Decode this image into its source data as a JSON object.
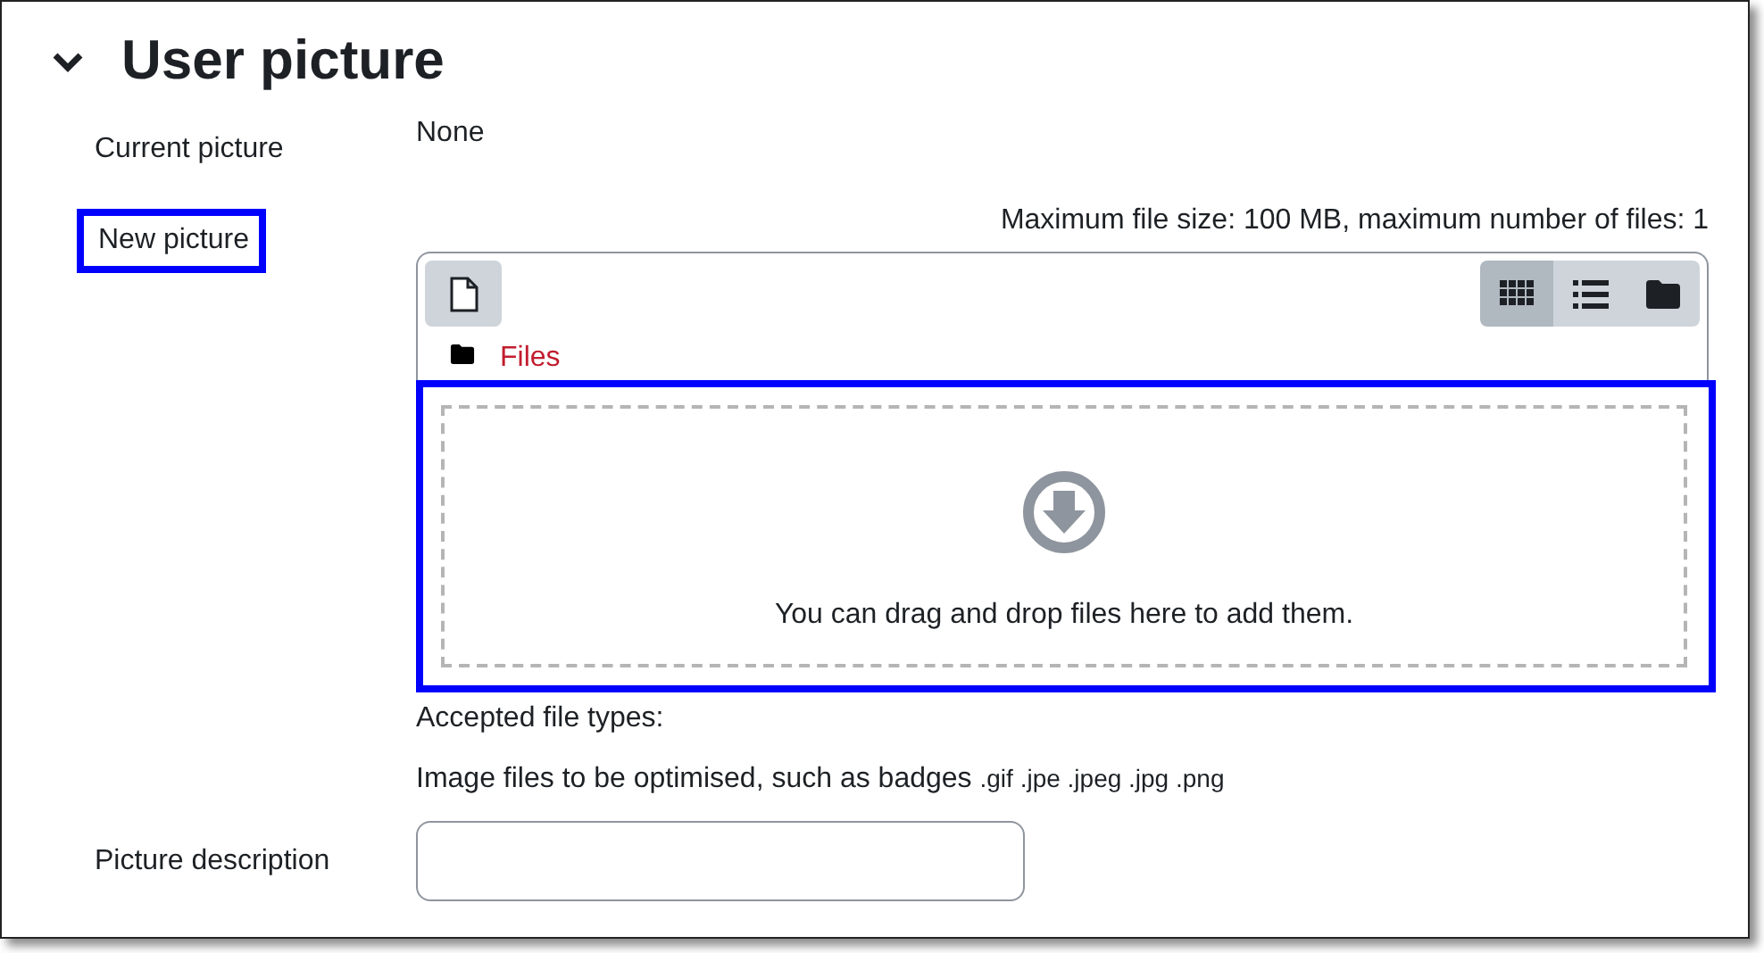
{
  "section": {
    "title": "User picture",
    "expanded": true
  },
  "current_picture": {
    "label": "Current picture",
    "value": "None"
  },
  "new_picture": {
    "label": "New picture",
    "highlighted": true,
    "limits": "Maximum file size: 100 MB, maximum number of files: 1",
    "view_buttons": [
      {
        "kind": "grid",
        "selected": true
      },
      {
        "kind": "list",
        "selected": false
      },
      {
        "kind": "folder",
        "selected": false
      }
    ],
    "path": "Files",
    "dropzone": {
      "text": "You can drag and drop files here to add them.",
      "highlighted": true
    },
    "accepted_label": "Accepted file types:",
    "accepted_types": "Image files to be optimised, such as badges",
    "extensions": ".gif .jpe .jpeg .jpg .png"
  },
  "picture_description": {
    "label": "Picture description"
  }
}
